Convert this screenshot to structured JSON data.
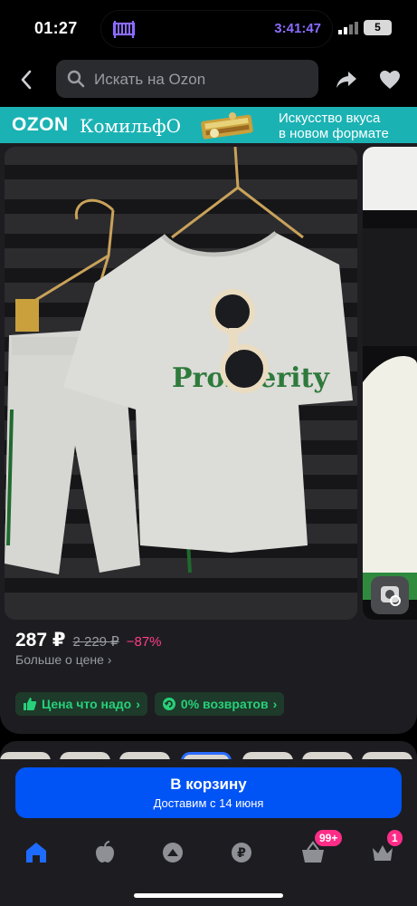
{
  "status_bar": {
    "time": "01:27",
    "timer": "3:41:47",
    "battery": "5"
  },
  "search": {
    "placeholder": "Искать на Ozon"
  },
  "banner": {
    "ozon": "OZON",
    "brand": "КомильфО",
    "tagline_line1": "Искусство вкуса",
    "tagline_line2": "в новом формате"
  },
  "product": {
    "print_text": "Prosperity",
    "price": "287 ₽",
    "old_price": "2 229 ₽",
    "discount": "−87%",
    "price_more": "Больше о цене",
    "badges": [
      {
        "label": "Цена что надо",
        "icon": "thumbs-up-icon"
      },
      {
        "label": "0% возвратов",
        "icon": "return-icon"
      }
    ]
  },
  "cart": {
    "title": "В корзину",
    "subtitle": "Доставим с 14 июня"
  },
  "nav": {
    "items": [
      {
        "name": "home",
        "icon": "home-icon"
      },
      {
        "name": "fresh",
        "icon": "apple-icon"
      },
      {
        "name": "profile",
        "icon": "profile-icon"
      },
      {
        "name": "finance",
        "icon": "ruble-icon"
      },
      {
        "name": "cart",
        "icon": "basket-icon"
      },
      {
        "name": "favorites",
        "icon": "crown-icon"
      }
    ],
    "cart_badge": "99+",
    "favorites_badge": "1"
  },
  "colors": {
    "accent_blue": "#0053f4",
    "badge_green": "#27d07a",
    "discount_pink": "#ff3d8b",
    "banner_teal": "#1bb2b4"
  }
}
